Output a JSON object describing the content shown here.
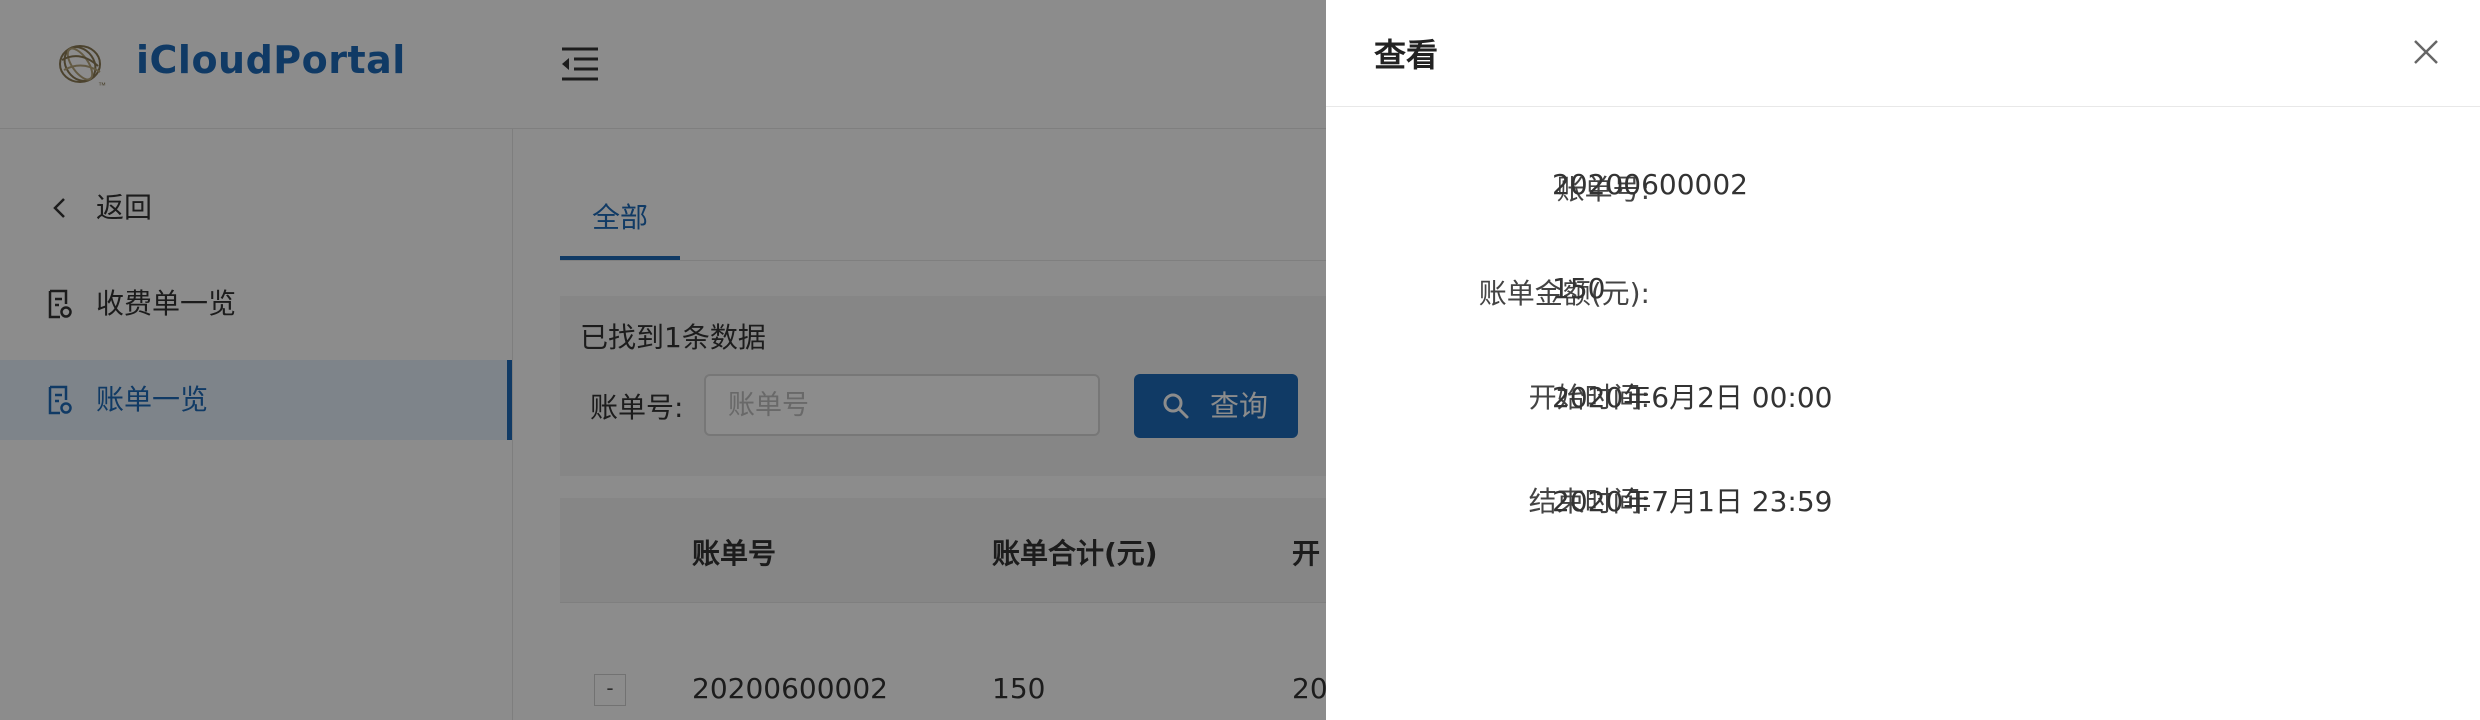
{
  "app": {
    "title": "iCloudPortal",
    "logo_icon": "globe-logo-icon"
  },
  "sidebar": {
    "items": [
      {
        "label": "返回",
        "icon": "chevron-left-icon"
      },
      {
        "label": "收费单一览",
        "icon": "document-icon"
      },
      {
        "label": "账单一览",
        "icon": "document-icon",
        "active": true
      }
    ]
  },
  "header": {
    "menu_icon": "menu-fold-icon"
  },
  "tabs": [
    {
      "label": "全部",
      "active": true
    }
  ],
  "filter": {
    "result_text": "已找到1条数据",
    "bill_no_label": "账单号:",
    "bill_no_placeholder": "账单号",
    "bill_no_value": "",
    "search_button": "查询"
  },
  "table": {
    "columns": [
      "账单号",
      "账单合计(元)",
      "开"
    ],
    "rows": [
      {
        "expand": "-",
        "bill_no": "20200600002",
        "total": "150",
        "start": "20"
      }
    ]
  },
  "drawer": {
    "title": "查看",
    "fields": [
      {
        "label": "账单号:",
        "value": "20200600002"
      },
      {
        "label": "账单金额(元):",
        "value": "150"
      },
      {
        "label": "开始时间:",
        "value": "2020年6月2日 00:00"
      },
      {
        "label": "结束时间:",
        "value": "2020年7月1日 23:59"
      }
    ]
  },
  "colors": {
    "primary": "#1e6bb8",
    "active_bg": "#e6f1fc",
    "panel_bg": "#f5f5f5",
    "mask": "rgba(0,0,0,0.45)"
  }
}
